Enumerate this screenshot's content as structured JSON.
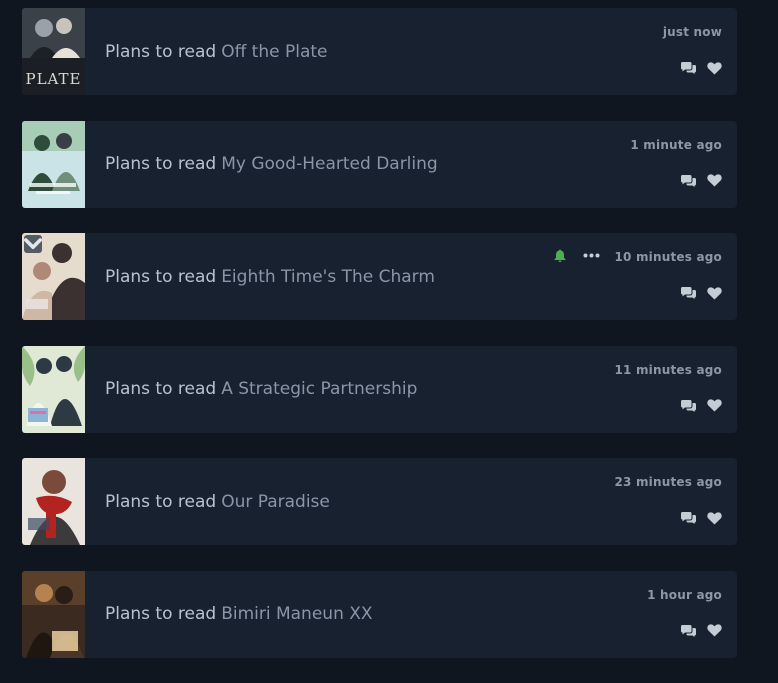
{
  "feed": [
    {
      "status": "Plans to read",
      "title": "Off the Plate",
      "time": "just now",
      "cover_colors": [
        "#2a2f37",
        "#9aa1a8",
        "#d9d8d2"
      ],
      "cover_text": "PLATE"
    },
    {
      "status": "Plans to read",
      "title": "My Good-Hearted Darling",
      "time": "1 minute ago",
      "cover_colors": [
        "#c9e3e6",
        "#2f4b3c",
        "#6f8f7c"
      ]
    },
    {
      "status": "Plans to read",
      "title": "Eighth Time's The Charm",
      "time": "10 minutes ago",
      "cover_colors": [
        "#e6dccd",
        "#3a3130",
        "#b08878"
      ],
      "has_extras": true
    },
    {
      "status": "Plans to read",
      "title": "A Strategic Partnership",
      "time": "11 minutes ago",
      "cover_colors": [
        "#dfe9d6",
        "#2d3a44",
        "#8db4d6"
      ]
    },
    {
      "status": "Plans to read",
      "title": "Our Paradise",
      "time": "23 minutes ago",
      "cover_colors": [
        "#e9e4de",
        "#b3231f",
        "#3d3a3c"
      ]
    },
    {
      "status": "Plans to read",
      "title": "Bimiri Maneun XX",
      "time": "1 hour ago",
      "cover_colors": [
        "#3a2a1f",
        "#b5834f",
        "#e9cfa0"
      ]
    }
  ],
  "icons": {
    "comment": "comments-icon",
    "like": "heart-icon",
    "bell": "bell-icon",
    "more": "more-options-icon",
    "toggle": "chevron-down-icon"
  },
  "colors": {
    "background": "#0f1620",
    "card": "#172130",
    "status_text": "#b9c3cf",
    "title_text": "#8a96a6",
    "time_text": "#8d98a6",
    "icon": "#c4ccd6",
    "bell": "#4caf50"
  }
}
